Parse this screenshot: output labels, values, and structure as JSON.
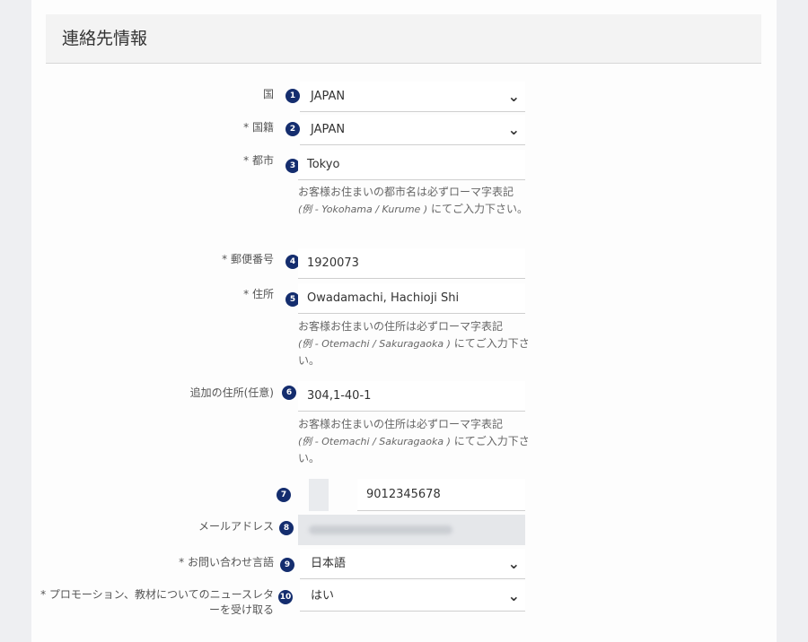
{
  "header": {
    "title": "連絡先情報"
  },
  "fields": [
    {
      "label": "国",
      "badge": "1",
      "value": "JAPAN"
    },
    {
      "label": "* 国籍",
      "badge": "2",
      "value": "JAPAN"
    },
    {
      "label": "* 都市",
      "badge": "3",
      "value": "Tokyo",
      "help_text": "お客様お住まいの都市名は必ずローマ字表記",
      "help_example": "(例 - Yokohama / Kurume )",
      "help_tail": "にてご入力下さい。"
    },
    {
      "label": "* 郵便番号",
      "badge": "4",
      "value": "1920073"
    },
    {
      "label": "* 住所",
      "badge": "5",
      "value": "Owadamachi, Hachioji Shi",
      "help_text": "お客様お住まいの住所は必ずローマ字表記",
      "help_example": "(例 - Otemachi / Sakuragaoka )",
      "help_tail": "にてご入力下さい。"
    },
    {
      "label": "追加の住所(任意)",
      "badge": "6",
      "value": "304,1-40-1",
      "help_text": "お客様お住まいの住所は必ずローマ字表記",
      "help_example": "(例 - Otemachi / Sakuragaoka )",
      "help_tail": "にてご入力下さい。"
    },
    {
      "label": "",
      "badge": "7",
      "value": "9012345678"
    },
    {
      "label": "メールアドレス",
      "badge": "8",
      "value": ""
    },
    {
      "label": "* お問い合わせ言語",
      "badge": "9",
      "value": "日本語"
    },
    {
      "label": "* プロモーション、教材についてのニュースレターを受け取る",
      "badge": "10",
      "value": "はい"
    }
  ],
  "icons": {
    "chevron": "chevron-down-icon"
  }
}
